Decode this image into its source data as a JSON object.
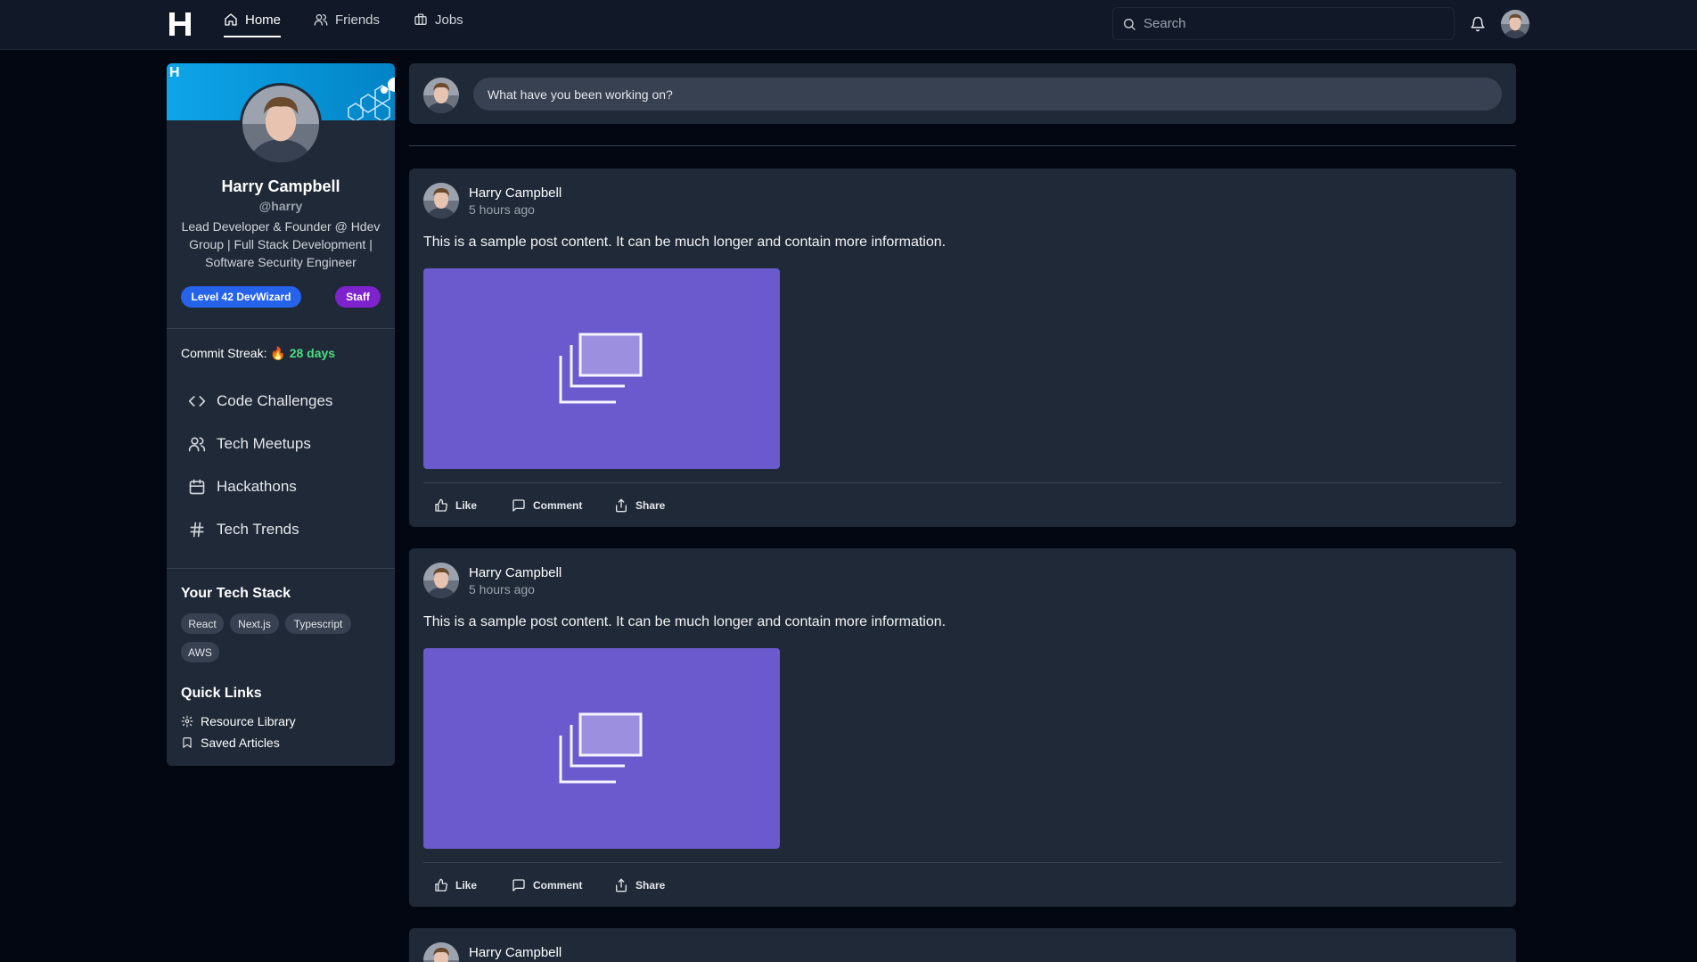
{
  "nav": {
    "logo": "H",
    "links": [
      {
        "label": "Home",
        "icon": "home-icon",
        "active": true
      },
      {
        "label": "Friends",
        "icon": "users-icon",
        "active": false
      },
      {
        "label": "Jobs",
        "icon": "briefcase-icon",
        "active": false
      }
    ],
    "search_placeholder": "Search"
  },
  "profile": {
    "name": "Harry Campbell",
    "handle": "@harry",
    "bio": "Lead Developer & Founder @ Hdev Group | Full Stack Development | Software Security Engineer",
    "badges": {
      "level": "Level 42 DevWizard",
      "role": "Staff"
    },
    "streak_label": "Commit Streak:",
    "streak_icon": "🔥",
    "streak_value": "28 days"
  },
  "menu": [
    {
      "label": "Code Challenges",
      "icon": "code-icon"
    },
    {
      "label": "Tech Meetups",
      "icon": "users-icon"
    },
    {
      "label": "Hackathons",
      "icon": "calendar-icon"
    },
    {
      "label": "Tech Trends",
      "icon": "hash-icon"
    }
  ],
  "tech_stack": {
    "title": "Your Tech Stack",
    "tags": [
      "React",
      "Next.js",
      "Typescript",
      "AWS"
    ]
  },
  "quick_links": {
    "title": "Quick Links",
    "items": [
      {
        "label": "Resource Library",
        "icon": "settings-icon"
      },
      {
        "label": "Saved Articles",
        "icon": "bookmark-icon"
      }
    ]
  },
  "composer": {
    "placeholder": "What have you been working on?"
  },
  "posts": [
    {
      "author": "Harry Campbell",
      "time": "5 hours ago",
      "content": "This is a sample post content. It can be much longer and contain more information."
    },
    {
      "author": "Harry Campbell",
      "time": "5 hours ago",
      "content": "This is a sample post content. It can be much longer and contain more information."
    },
    {
      "author": "Harry Campbell"
    }
  ],
  "actions": {
    "like": "Like",
    "comment": "Comment",
    "share": "Share"
  },
  "colors": {
    "background": "#030712",
    "card": "#1f2937",
    "level_badge": "#2563eb",
    "staff_badge": "#7e22ce",
    "streak": "#4ade80",
    "media_placeholder": "#6a5acd"
  }
}
